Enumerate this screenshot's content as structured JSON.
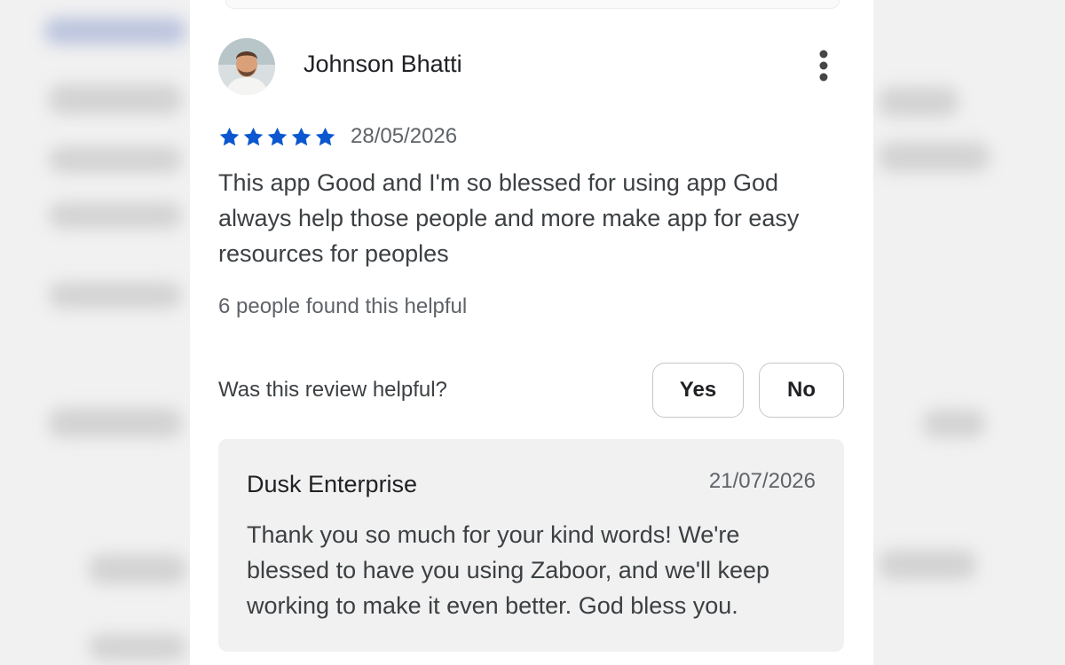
{
  "review": {
    "reviewer_name": "Johnson Bhatti",
    "rating": 5,
    "date": "28/05/2026",
    "text": "This app Good and I'm so blessed for using app God always help those people and more make app for easy resources for peoples",
    "helpful_count_text": "6 people found this helpful",
    "helpful_question": "Was this review helpful?",
    "yes_label": "Yes",
    "no_label": "No",
    "more_icon": "more-vert-icon",
    "star_color": "#0b57d0"
  },
  "developer_reply": {
    "developer_name": "Dusk Enterprise",
    "date": "21/07/2026",
    "text": "Thank you so much for your kind words! We're blessed to have you using Zaboor, and we'll keep working to make it even better. God bless you."
  }
}
